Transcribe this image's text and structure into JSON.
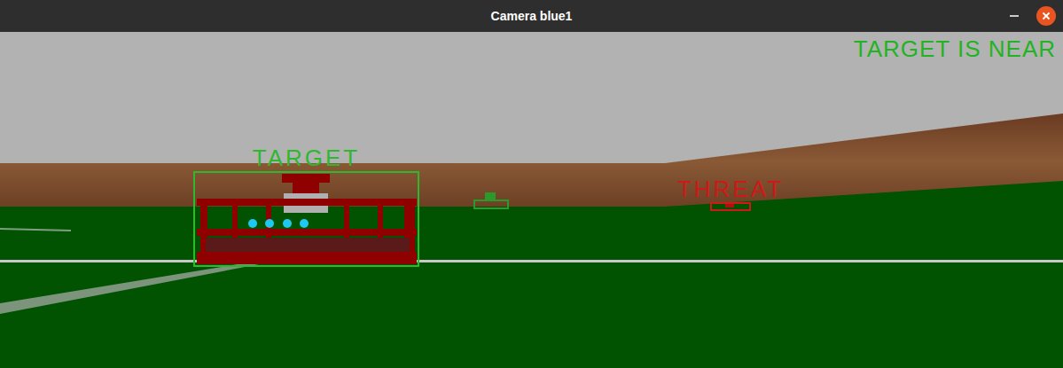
{
  "window": {
    "title": "Camera blue1"
  },
  "status": {
    "text": "TARGET IS NEAR",
    "color": "#22b322"
  },
  "detections": [
    {
      "label": "TARGET",
      "color": "#2eb82e"
    },
    {
      "label": "THREAT",
      "color": "#d01818"
    }
  ]
}
